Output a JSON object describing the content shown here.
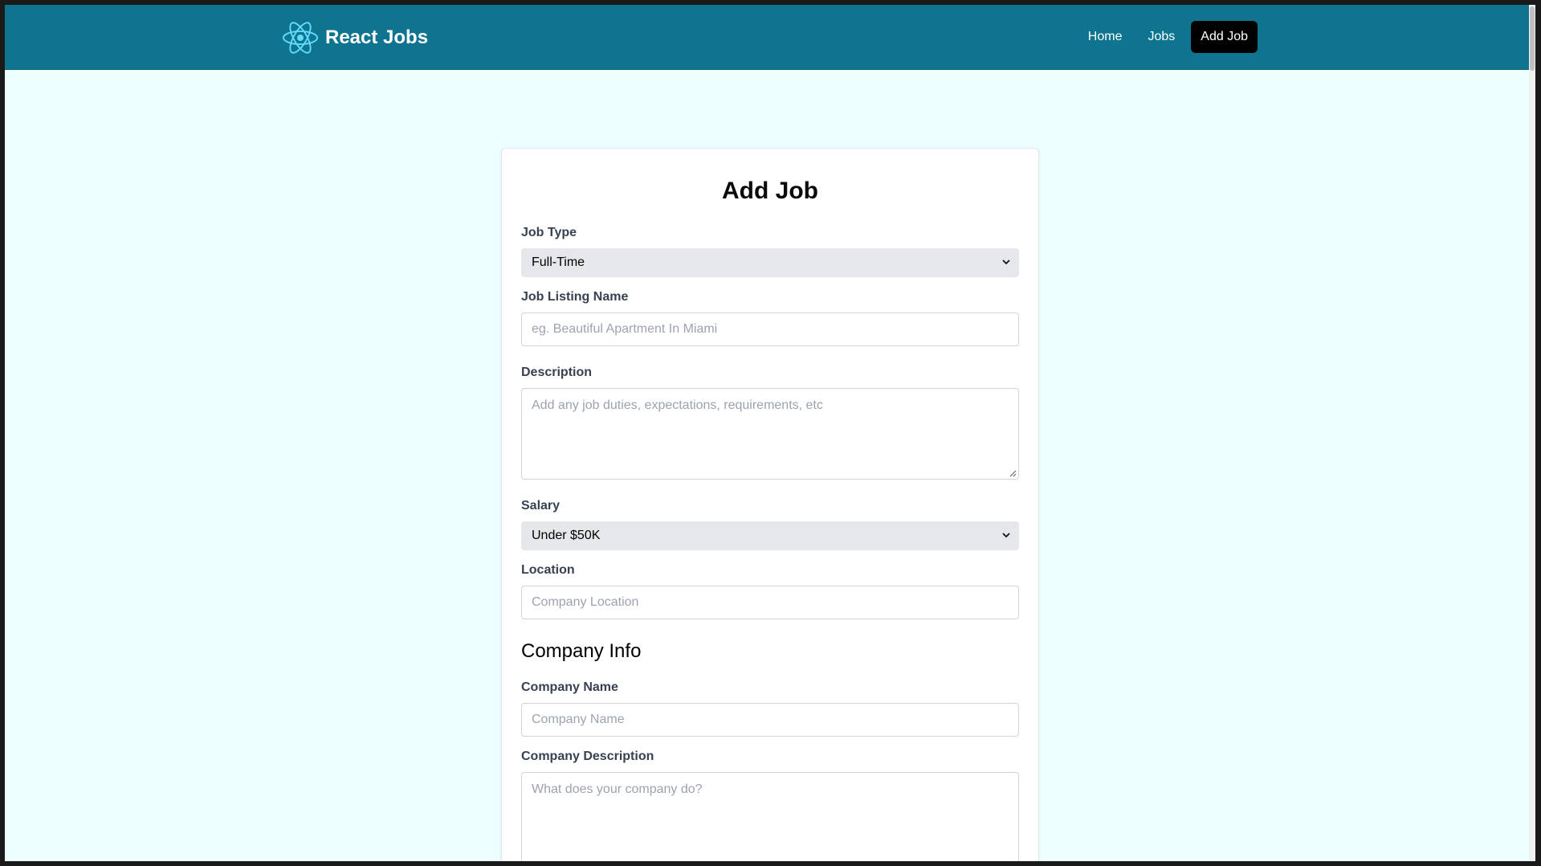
{
  "navbar": {
    "brand": "React Jobs",
    "links": [
      {
        "label": "Home",
        "active": false
      },
      {
        "label": "Jobs",
        "active": false
      },
      {
        "label": "Add Job",
        "active": true
      }
    ]
  },
  "form": {
    "title": "Add Job",
    "job_type": {
      "label": "Job Type",
      "value": "Full-Time"
    },
    "job_listing_name": {
      "label": "Job Listing Name",
      "placeholder": "eg. Beautiful Apartment In Miami"
    },
    "description": {
      "label": "Description",
      "placeholder": "Add any job duties, expectations, requirements, etc"
    },
    "salary": {
      "label": "Salary",
      "value": "Under $50K"
    },
    "location": {
      "label": "Location",
      "placeholder": "Company Location"
    },
    "company_section_title": "Company Info",
    "company_name": {
      "label": "Company Name",
      "placeholder": "Company Name"
    },
    "company_description": {
      "label": "Company Description",
      "placeholder": "What does your company do?"
    }
  },
  "colors": {
    "navbar_bg": "#0e7490",
    "page_bg": "#ecfeff",
    "active_link_bg": "#000000",
    "select_bg": "#e5e7eb"
  },
  "icons": {
    "brand_logo": "react-logo-icon",
    "select_arrow": "chevron-down-icon"
  }
}
